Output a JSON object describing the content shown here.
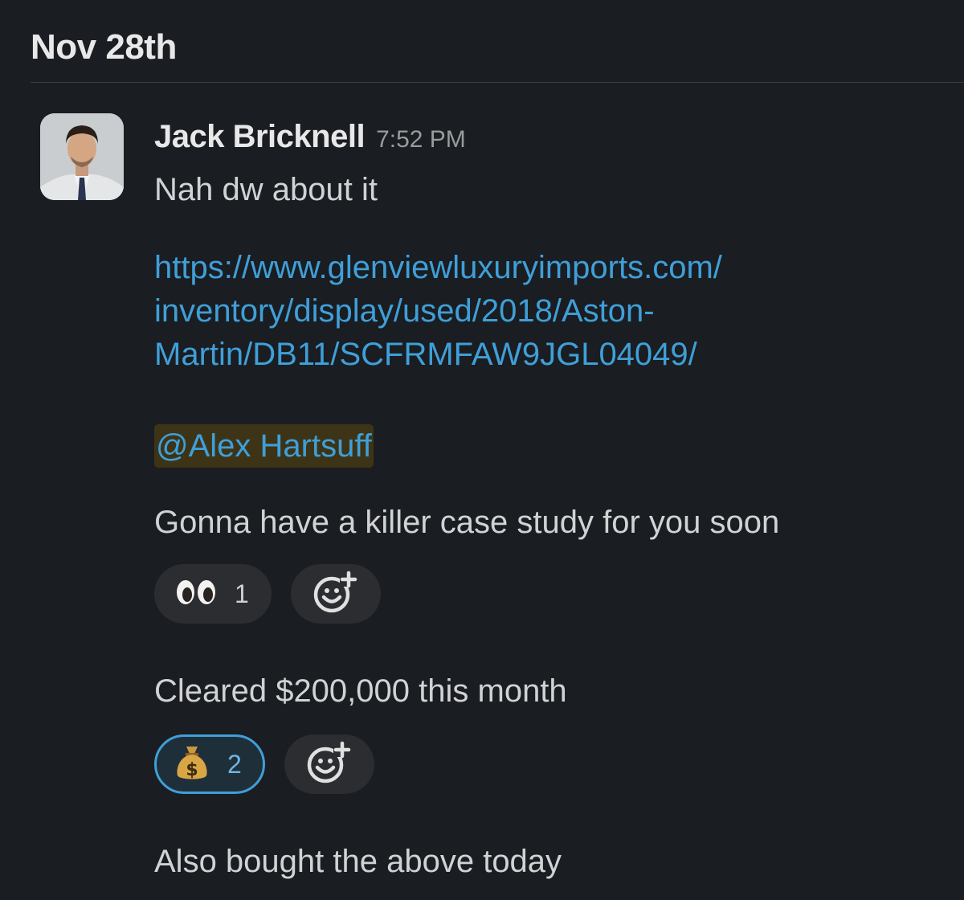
{
  "day_header": "Nov 28th",
  "message": {
    "author": "Jack Bricknell",
    "time": "7:52 PM",
    "line1": "Nah dw about it",
    "link_lines": [
      "https://www.glenviewluxuryimports.com/",
      "inventory/display/used/2018/Aston-",
      "Martin/DB11/SCFRMFAW9JGL04049/"
    ],
    "mention": "@Alex Hartsuff",
    "line2": "Gonna have a killer case study for you soon",
    "reaction1": {
      "emoji": "eyes",
      "count": "1"
    },
    "line3": "Cleared $200,000 this month",
    "reaction2": {
      "emoji": "money-bag",
      "count": "2",
      "active": true
    },
    "line4": "Also bought the above today"
  },
  "colors": {
    "background": "#1a1d21",
    "link": "#3f9fd8",
    "mention_bg": "#3d3418",
    "pill_bg": "#2b2d31"
  },
  "icons": [
    "eyes-emoji-icon",
    "money-bag-emoji-icon",
    "add-reaction-icon"
  ]
}
